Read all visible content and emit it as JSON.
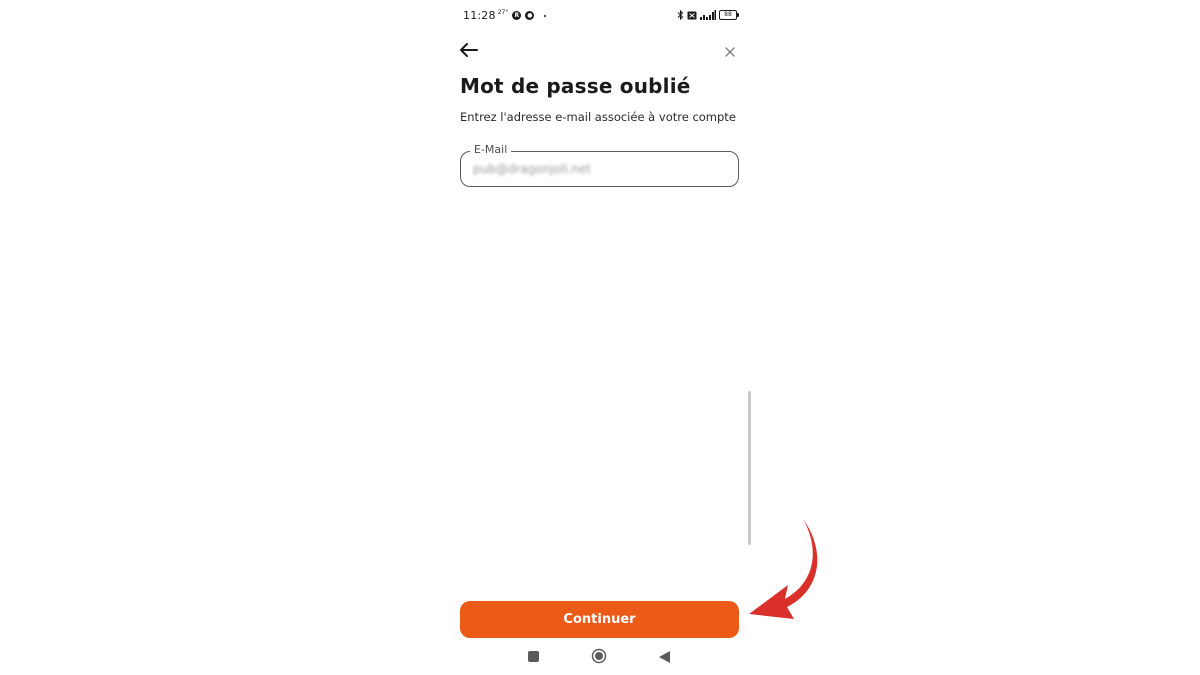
{
  "status_bar": {
    "time": "11:28",
    "temperature": "27°",
    "battery": "88"
  },
  "header": {
    "back_icon": "arrow-left-icon",
    "close_icon": "close-icon"
  },
  "page": {
    "title": "Mot de passe oublié",
    "subtitle": "Entrez l'adresse e-mail associée à votre compte"
  },
  "email_field": {
    "label": "E-Mail",
    "value": "pub@dragonjoli.net"
  },
  "actions": {
    "continue_label": "Continuer"
  },
  "nav_bar": {
    "recents_icon": "square-icon",
    "home_icon": "circle-home-icon",
    "back_icon": "triangle-back-icon"
  },
  "colors": {
    "accent": "#ec5a18",
    "annotation_arrow": "#d9302b",
    "text_primary": "#1a1a1a",
    "field_border": "#5a5a5a"
  }
}
